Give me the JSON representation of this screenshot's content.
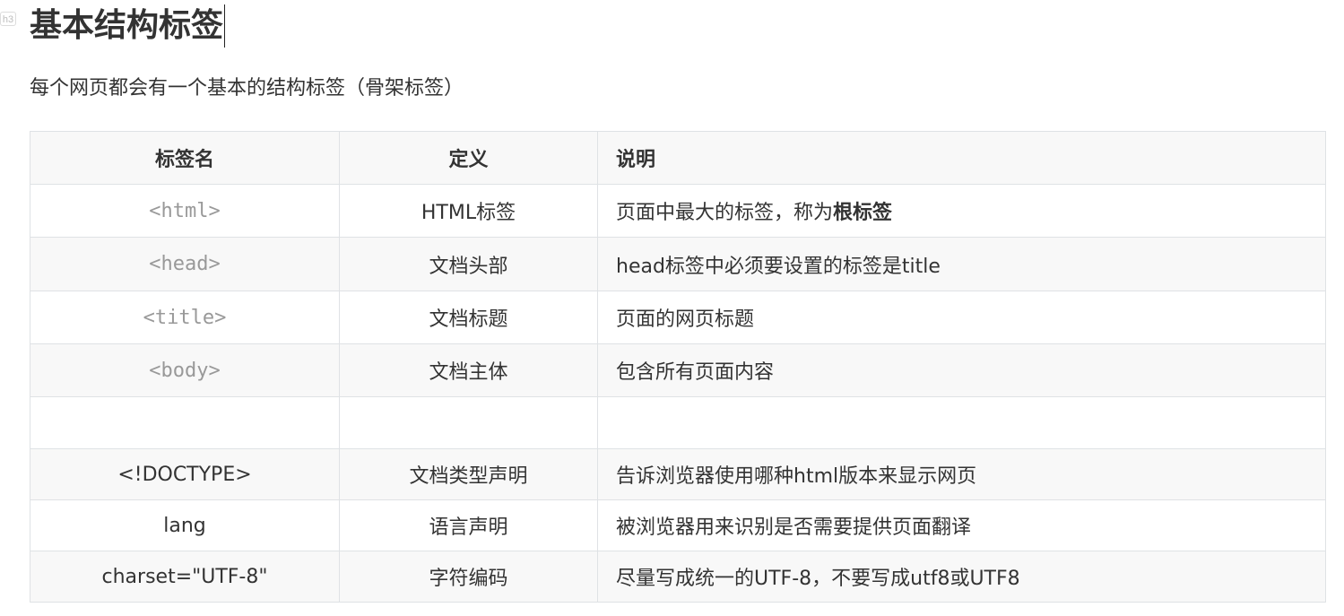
{
  "heading": {
    "badge": "h3",
    "title": "基本结构标签"
  },
  "intro": "每个网页都会有一个基本的结构标签（骨架标签）",
  "table": {
    "headers": [
      "标签名",
      "定义",
      "说明"
    ],
    "rows": [
      {
        "name": "<html>",
        "definition": "HTML标签",
        "desc_prefix": "页面中最大的标签，称为",
        "desc_bold": "根标签"
      },
      {
        "name": "<head>",
        "definition": "文档头部",
        "description": "head标签中必须要设置的标签是title"
      },
      {
        "name": "<title>",
        "definition": "文档标题",
        "description": "页面的网页标题"
      },
      {
        "name": "<body>",
        "definition": "文档主体",
        "description": "包含所有页面内容"
      },
      {
        "name": "",
        "definition": "",
        "description": ""
      },
      {
        "name": "<!DOCTYPE>",
        "definition": "文档类型声明",
        "description": "告诉浏览器使用哪种html版本来显示网页"
      },
      {
        "name": "lang",
        "definition": "语言声明",
        "description": "被浏览器用来识别是否需要提供页面翻译"
      },
      {
        "name": "charset=\"UTF-8\"",
        "definition": "字符编码",
        "description": "尽量写成统一的UTF-8，不要写成utf8或UTF8"
      }
    ]
  }
}
